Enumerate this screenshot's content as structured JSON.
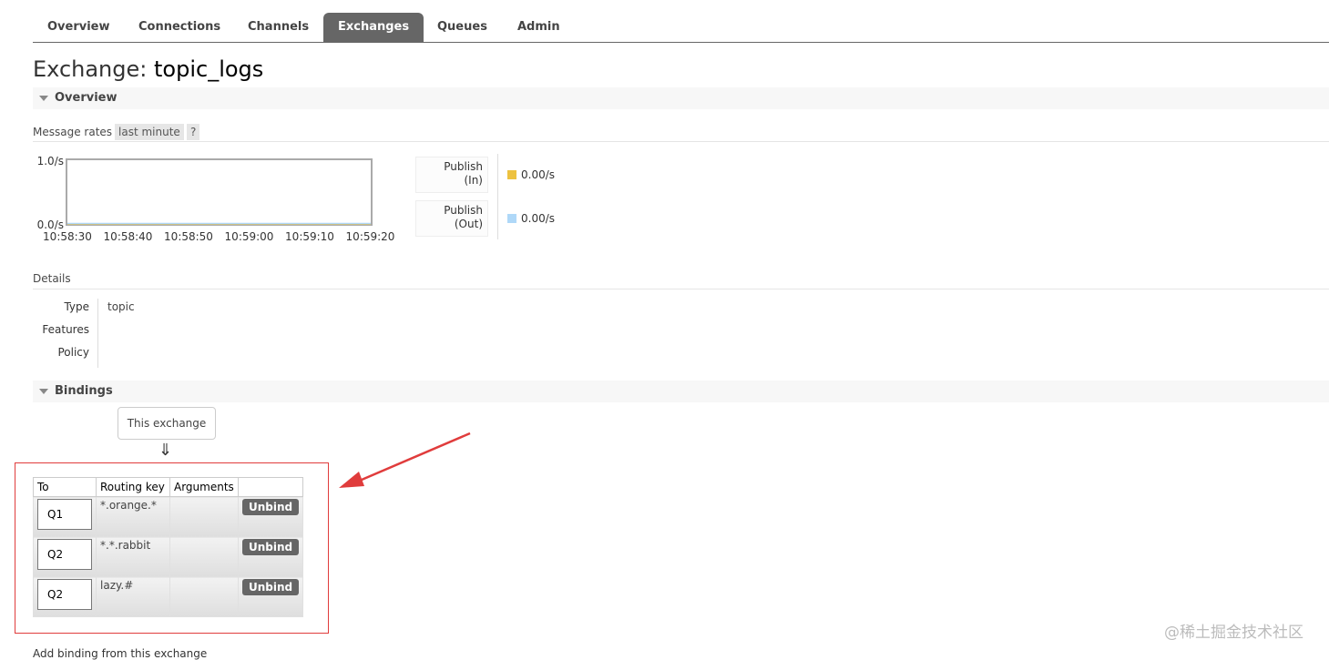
{
  "nav": {
    "tabs": [
      "Overview",
      "Connections",
      "Channels",
      "Exchanges",
      "Queues",
      "Admin"
    ],
    "active": "Exchanges"
  },
  "page": {
    "title_prefix": "Exchange:",
    "exchange_name": "topic_logs"
  },
  "overview_section": {
    "label": "Overview",
    "message_rates_label": "Message rates",
    "range_button": "last minute",
    "help_button": "?"
  },
  "chart_data": {
    "type": "line",
    "x": [
      "10:58:30",
      "10:58:40",
      "10:58:50",
      "10:59:00",
      "10:59:10",
      "10:59:20"
    ],
    "ytick_labels": [
      "1.0/s",
      "0.0/s"
    ],
    "ylim": [
      0,
      1
    ],
    "series": [
      {
        "name": "Publish (In)",
        "values": [
          0,
          0,
          0,
          0,
          0,
          0
        ],
        "color": "#edc240"
      },
      {
        "name": "Publish (Out)",
        "values": [
          0,
          0,
          0,
          0,
          0,
          0
        ],
        "color": "#afd8f8"
      }
    ]
  },
  "legend": [
    {
      "line1": "Publish",
      "line2": "(In)",
      "value": "0.00/s",
      "color": "#edc240"
    },
    {
      "line1": "Publish",
      "line2": "(Out)",
      "value": "0.00/s",
      "color": "#afd8f8"
    }
  ],
  "details": {
    "heading": "Details",
    "rows": [
      {
        "key": "Type",
        "value": "topic"
      },
      {
        "key": "Features",
        "value": ""
      },
      {
        "key": "Policy",
        "value": ""
      }
    ]
  },
  "bindings_section": {
    "label": "Bindings",
    "source_label": "This exchange",
    "arrow": "⇓",
    "columns": [
      "To",
      "Routing key",
      "Arguments",
      ""
    ],
    "rows": [
      {
        "to": "Q1",
        "routing_key": "*.orange.*",
        "arguments": "",
        "action": "Unbind"
      },
      {
        "to": "Q2",
        "routing_key": "*.*.rabbit",
        "arguments": "",
        "action": "Unbind"
      },
      {
        "to": "Q2",
        "routing_key": "lazy.#",
        "arguments": "",
        "action": "Unbind"
      }
    ]
  },
  "add_binding_label": "Add binding from this exchange",
  "watermark": "@稀土掘金技术社区"
}
